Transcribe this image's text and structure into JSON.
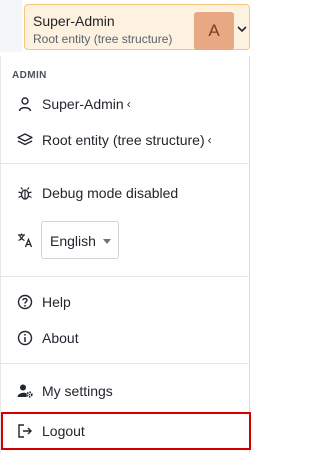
{
  "header": {
    "user_name": "Super-Admin",
    "entity": "Root entity (tree structure)",
    "avatar_letter": "A"
  },
  "menu": {
    "section_label": "ADMIN",
    "profile_label": "Super-Admin",
    "entity_label": "Root entity (tree structure)",
    "debug_label": "Debug mode disabled",
    "language_value": "English",
    "help_label": "Help",
    "about_label": "About",
    "settings_label": "My settings",
    "logout_label": "Logout",
    "chevron": "‹"
  },
  "colors": {
    "chip_background": "#fdf1df",
    "avatar_background": "#e8a884",
    "highlight": "#d40000"
  },
  "icons": [
    "user-icon",
    "layers-icon",
    "bug-icon",
    "language-icon",
    "help-circle-icon",
    "info-circle-icon",
    "user-cog-icon",
    "logout-icon",
    "chevron-down-icon"
  ]
}
